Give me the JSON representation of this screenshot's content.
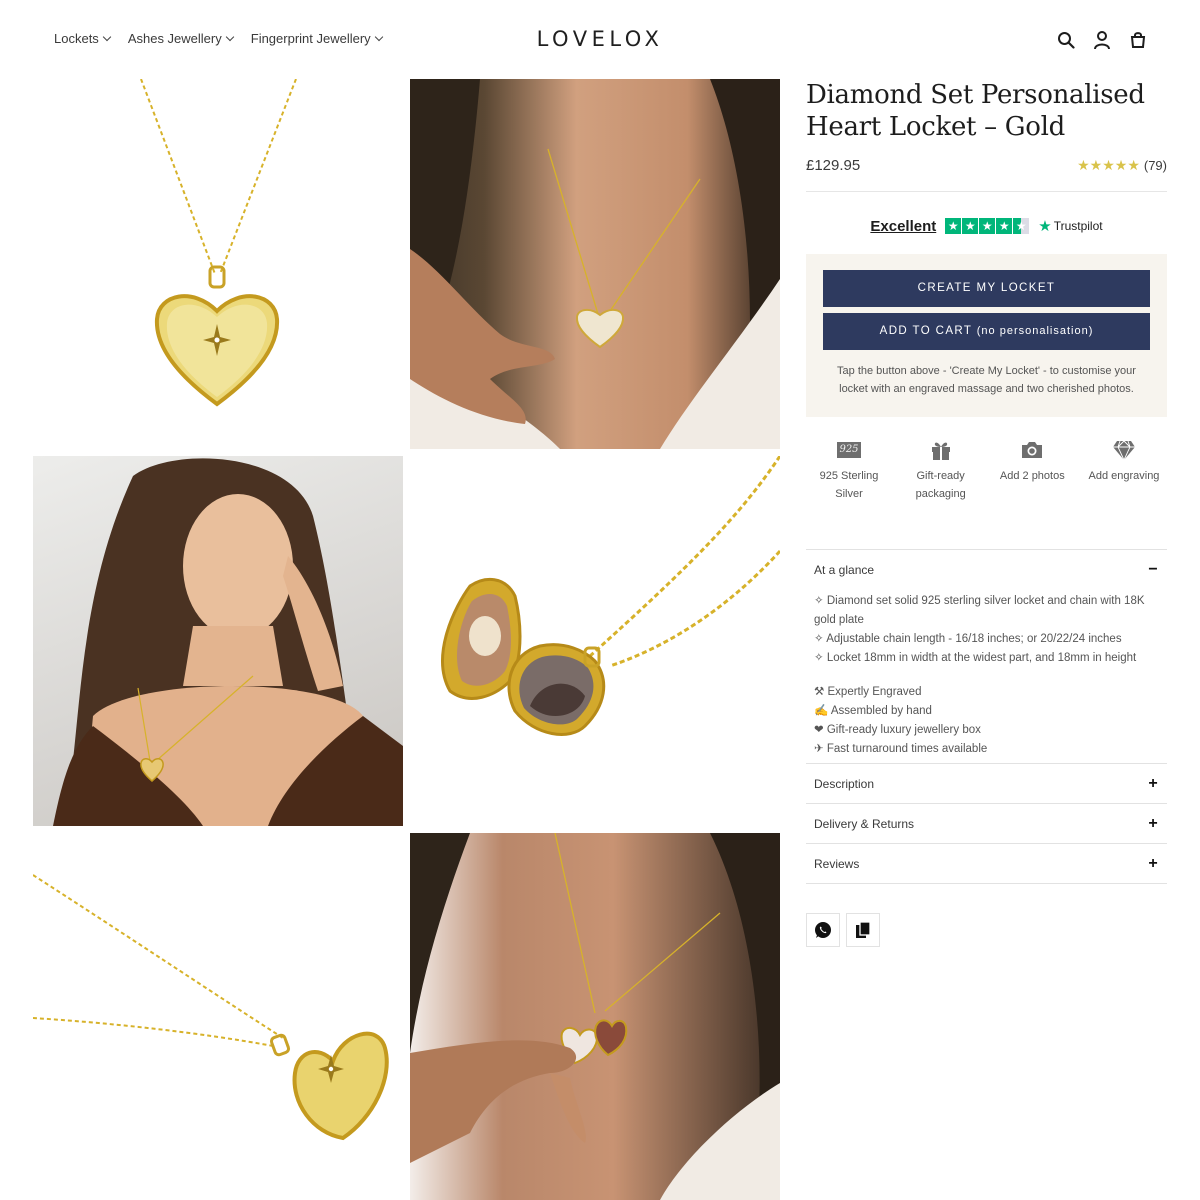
{
  "header": {
    "nav": [
      {
        "label": "Lockets"
      },
      {
        "label": "Ashes Jewellery"
      },
      {
        "label": "Fingerprint Jewellery"
      }
    ],
    "logo": "LOVELOX",
    "icons": [
      "search-icon",
      "account-icon",
      "cart-icon"
    ]
  },
  "gallery": [
    {
      "name": "heart-locket-product"
    },
    {
      "name": "model-wearing-locket"
    },
    {
      "name": "model-portrait"
    },
    {
      "name": "open-locket-photos"
    },
    {
      "name": "locket-angled"
    },
    {
      "name": "model-holding-open-locket"
    }
  ],
  "product": {
    "title": "Diamond Set Personalised Heart Locket – Gold",
    "price": "£129.95",
    "rating": {
      "stars": 5,
      "count": "(79)"
    },
    "trustpilot": {
      "word": "Excellent",
      "brand": "Trustpilot",
      "score": 4.5
    },
    "cta": {
      "create": "CREATE MY LOCKET",
      "add_main": "ADD TO CART",
      "add_sub": "(no personalisation)",
      "note": "Tap the button above - 'Create My Locket' - to customise your locket with an engraved massage and two cherished photos."
    },
    "features": [
      {
        "icon": "sterling-925-icon",
        "badge": "925",
        "label": "925 Sterling Silver"
      },
      {
        "icon": "gift-icon",
        "label": "Gift-ready packaging"
      },
      {
        "icon": "camera-icon",
        "label": "Add 2 photos"
      },
      {
        "icon": "diamond-icon",
        "label": "Add engraving"
      }
    ],
    "accordion": {
      "glance": {
        "title": "At a glance",
        "sign": "−",
        "lines": [
          "✧ Diamond set solid 925 sterling silver locket and chain with 18K gold plate",
          "✧ Adjustable chain length - 16/18 inches; or 20/22/24 inches",
          "✧ Locket 18mm in width at the widest part, and 18mm in height"
        ],
        "perks": [
          "⚒ Expertly Engraved",
          "✍ Assembled by hand",
          "❤ Gift-ready luxury jewellery box",
          "✈ Fast turnaround times available"
        ]
      },
      "description": {
        "title": "Description",
        "sign": "+"
      },
      "delivery": {
        "title": "Delivery & Returns",
        "sign": "+"
      },
      "reviews": {
        "title": "Reviews",
        "sign": "+"
      }
    },
    "share": [
      "whatsapp-icon",
      "copy-link-icon"
    ]
  },
  "colors": {
    "button": "#2e3a5f",
    "cta_bg": "#f7f4ee",
    "stars": "#d9c34a",
    "trustpilot": "#00b67a",
    "gold": "#d7b22a"
  }
}
